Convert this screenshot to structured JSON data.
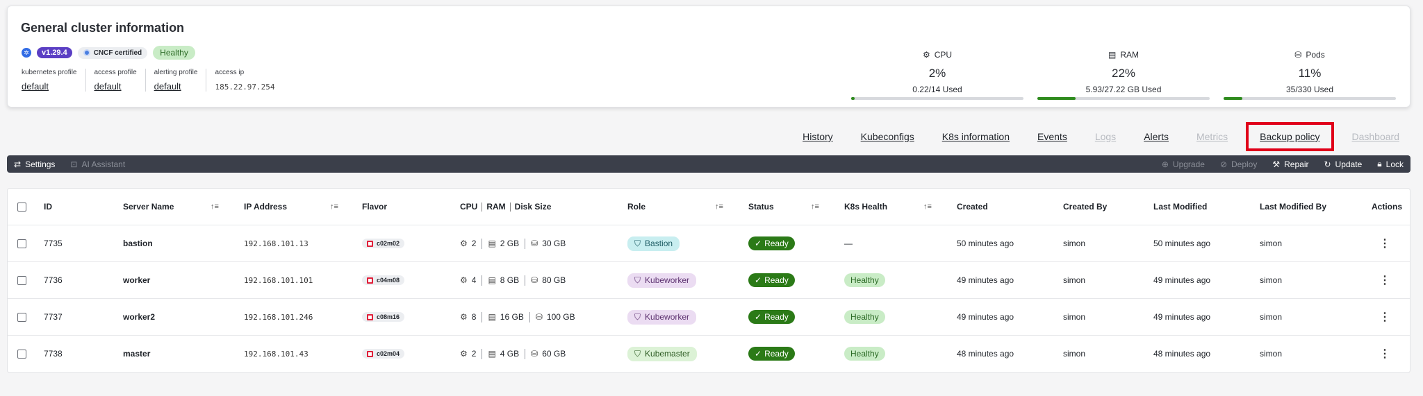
{
  "cluster": {
    "title": "General cluster information",
    "version": "v1.29.4",
    "cncf": "CNCF certified",
    "health": "Healthy",
    "profiles": [
      {
        "label": "kubernetes profile",
        "value": "default"
      },
      {
        "label": "access profile",
        "value": "default"
      },
      {
        "label": "alerting profile",
        "value": "default"
      },
      {
        "label": "access ip",
        "value": "185.22.97.254"
      }
    ],
    "metrics": [
      {
        "name": "CPU",
        "percent": "2%",
        "used": "0.22/14 Used",
        "fill": 0.02
      },
      {
        "name": "RAM",
        "percent": "22%",
        "used": "5.93/27.22 GB Used",
        "fill": 0.22
      },
      {
        "name": "Pods",
        "percent": "11%",
        "used": "35/330 Used",
        "fill": 0.11
      }
    ]
  },
  "tabs": [
    {
      "label": "History",
      "state": "normal"
    },
    {
      "label": "Kubeconfigs",
      "state": "normal"
    },
    {
      "label": "K8s information",
      "state": "normal"
    },
    {
      "label": "Events",
      "state": "normal"
    },
    {
      "label": "Logs",
      "state": "disabled"
    },
    {
      "label": "Alerts",
      "state": "normal"
    },
    {
      "label": "Metrics",
      "state": "disabled"
    },
    {
      "label": "Backup policy",
      "state": "active"
    },
    {
      "label": "Dashboard",
      "state": "disabled"
    }
  ],
  "toolbar": {
    "settings": "Settings",
    "ai_assistant": "AI Assistant",
    "upgrade": "Upgrade",
    "deploy": "Deploy",
    "repair": "Repair",
    "update": "Update",
    "lock": "Lock"
  },
  "table": {
    "headers": {
      "id": "ID",
      "server_name": "Server Name",
      "ip": "IP Address",
      "flavor": "Flavor",
      "cpu": "CPU",
      "ram": "RAM",
      "disk": "Disk Size",
      "role": "Role",
      "status": "Status",
      "k8s_health": "K8s Health",
      "created": "Created",
      "created_by": "Created By",
      "last_modified": "Last Modified",
      "last_modified_by": "Last Modified By",
      "actions": "Actions"
    },
    "rows": [
      {
        "id": "7735",
        "name": "bastion",
        "ip": "192.168.101.13",
        "flavor": "c02m02",
        "cpu": "2",
        "ram": "2 GB",
        "disk": "30 GB",
        "role": "Bastion",
        "role_kind": "bastion",
        "status": "Ready",
        "k8s_health": "—",
        "created": "50 minutes ago",
        "created_by": "simon",
        "last_modified": "50 minutes ago",
        "last_modified_by": "simon"
      },
      {
        "id": "7736",
        "name": "worker",
        "ip": "192.168.101.101",
        "flavor": "c04m08",
        "cpu": "4",
        "ram": "8 GB",
        "disk": "80 GB",
        "role": "Kubeworker",
        "role_kind": "kubeworker",
        "status": "Ready",
        "k8s_health": "Healthy",
        "created": "49 minutes ago",
        "created_by": "simon",
        "last_modified": "49 minutes ago",
        "last_modified_by": "simon"
      },
      {
        "id": "7737",
        "name": "worker2",
        "ip": "192.168.101.246",
        "flavor": "c08m16",
        "cpu": "8",
        "ram": "16 GB",
        "disk": "100 GB",
        "role": "Kubeworker",
        "role_kind": "kubeworker",
        "status": "Ready",
        "k8s_health": "Healthy",
        "created": "49 minutes ago",
        "created_by": "simon",
        "last_modified": "49 minutes ago",
        "last_modified_by": "simon"
      },
      {
        "id": "7738",
        "name": "master",
        "ip": "192.168.101.43",
        "flavor": "c02m04",
        "cpu": "2",
        "ram": "4 GB",
        "disk": "60 GB",
        "role": "Kubemaster",
        "role_kind": "kubemaster",
        "status": "Ready",
        "k8s_health": "Healthy",
        "created": "48 minutes ago",
        "created_by": "simon",
        "last_modified": "48 minutes ago",
        "last_modified_by": "simon"
      }
    ]
  }
}
